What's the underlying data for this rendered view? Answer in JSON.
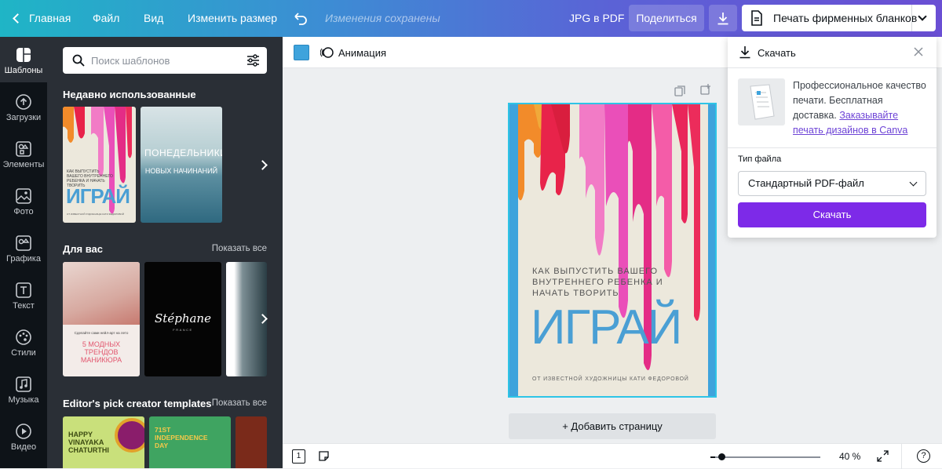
{
  "topbar": {
    "home": "Главная",
    "file": "Файл",
    "view": "Вид",
    "resize": "Изменить размер",
    "saved": "Изменения сохранены",
    "jpg_pdf": "JPG в PDF",
    "share": "Поделиться",
    "print": "Печать фирменных бланков"
  },
  "rail": [
    {
      "label": "Шаблоны",
      "icon": "templates-icon"
    },
    {
      "label": "Загрузки",
      "icon": "upload-icon"
    },
    {
      "label": "Элементы",
      "icon": "elements-icon"
    },
    {
      "label": "Фото",
      "icon": "photo-icon"
    },
    {
      "label": "Графика",
      "icon": "graphics-icon"
    },
    {
      "label": "Текст",
      "icon": "text-icon"
    },
    {
      "label": "Стили",
      "icon": "palette-icon"
    },
    {
      "label": "Музыка",
      "icon": "music-icon"
    },
    {
      "label": "Видео",
      "icon": "video-icon"
    }
  ],
  "panel": {
    "search_placeholder": "Поиск шаблонов",
    "recent_title": "Недавно использованные",
    "for_you_title": "Для вас",
    "editors_title": "Editor's pick creator templates",
    "show_all": "Показать все",
    "thumbs": {
      "play_lines": "КАК ВЫПУСТИТЬ ВАШЕГО ВНУТРЕННЕГО РЕБЕНКА И НАЧАТЬ ТВОРИТЬ",
      "play_big": "ИГРАЙ",
      "play_small": "ОТ ИЗВЕСТНОЙ ХУДОЖНИЦЫ КАТИ ФЕДОРОВОЙ",
      "monday_1": "ПОНЕДЕЛЬНИКИ",
      "monday_2": "НОВЫХ НАЧИНАНИЙ",
      "nails_small": "Сделайте сами нейл-арт на лето",
      "nails_big": "5 МОДНЫХ ТРЕНДОВ МАНИКЮРА",
      "stephane": "Stéphane",
      "france": "FRANCE",
      "vinayaka": "HAPPY VINAYAKA CHATURTHI",
      "independence": "71ST INDEPENDENCE DAY"
    }
  },
  "toolbar": {
    "animation": "Анимация"
  },
  "canvas": {
    "subtitle": "КАК ВЫПУСТИТЬ ВАШЕГО ВНУТРЕННЕГО РЕБЕНКА И НАЧАТЬ ТВОРИТЬ",
    "title": "ИГРАЙ",
    "author": "ОТ ИЗВЕСТНОЙ ХУДОЖНИЦЫ КАТИ ФЕДОРОВОЙ",
    "add_page": "+ Добавить страницу"
  },
  "status": {
    "page_num": "1",
    "zoom": "40 %",
    "help": "?"
  },
  "download_panel": {
    "title": "Скачать",
    "promo_text": "Профессиональное качество печати. Бесплатная доставка.",
    "promo_link": "Заказывайте печать дизайнов в Canva",
    "file_type_label": "Тип файла",
    "file_type_value": "Стандартный PDF-файл",
    "download_button": "Скачать"
  },
  "colors": {
    "accent": "#7d2ae8",
    "page_bg": "#3ea3dc",
    "title_blue": "#4a9fd4"
  }
}
